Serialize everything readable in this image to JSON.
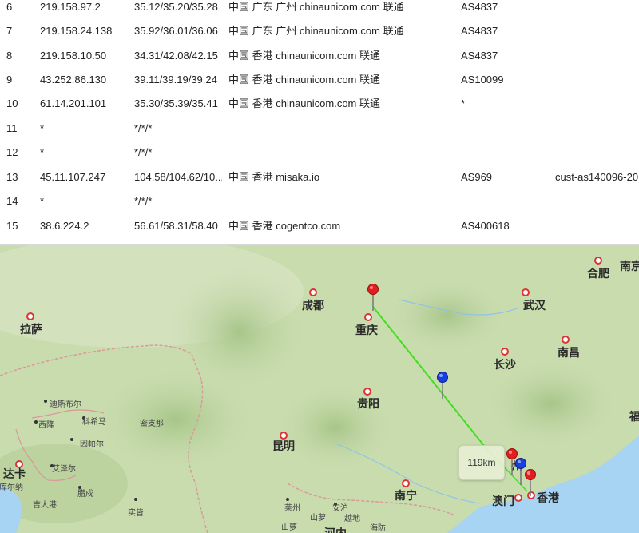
{
  "trace": {
    "rows": [
      {
        "hop": "6",
        "ip": "219.158.97.2",
        "latency": "35.12/35.20/35.28",
        "location": "中国 广东 广州 chinaunicom.com 联通",
        "asn": "AS4837",
        "host": ""
      },
      {
        "hop": "7",
        "ip": "219.158.24.138",
        "latency": "35.92/36.01/36.06",
        "location": "中国 广东 广州 chinaunicom.com 联通",
        "asn": "AS4837",
        "host": ""
      },
      {
        "hop": "8",
        "ip": "219.158.10.50",
        "latency": "34.31/42.08/42.15",
        "location": "中国 香港 chinaunicom.com 联通",
        "asn": "AS4837",
        "host": ""
      },
      {
        "hop": "9",
        "ip": "43.252.86.130",
        "latency": "39.11/39.19/39.24",
        "location": "中国 香港 chinaunicom.com 联通",
        "asn": "AS10099",
        "host": ""
      },
      {
        "hop": "10",
        "ip": "61.14.201.101",
        "latency": "35.30/35.39/35.41",
        "location": "中国 香港 chinaunicom.com 联通",
        "asn": "*",
        "host": ""
      },
      {
        "hop": "11",
        "ip": "*",
        "latency": "*/*/*",
        "location": "",
        "asn": "",
        "host": ""
      },
      {
        "hop": "12",
        "ip": "*",
        "latency": "*/*/*",
        "location": "",
        "asn": "",
        "host": ""
      },
      {
        "hop": "13",
        "ip": "45.11.107.247",
        "latency": "104.58/104.62/10...",
        "location": "中国 香港 misaka.io",
        "asn": "AS969",
        "host": "cust-as140096-20"
      },
      {
        "hop": "14",
        "ip": "*",
        "latency": "*/*/*",
        "location": "",
        "asn": "",
        "host": ""
      },
      {
        "hop": "15",
        "ip": "38.6.224.2",
        "latency": "56.61/58.31/58.40",
        "location": "中国 香港 cogentco.com",
        "asn": "AS400618",
        "host": ""
      }
    ]
  },
  "map": {
    "distance_label": "119km",
    "colors": {
      "route_line": "#44dd22",
      "pin_red": "#e02020",
      "pin_blue": "#1a3fe0",
      "land": "#c9dcae",
      "mountains": "#b2cc92",
      "sea": "#a6d4f2",
      "border": "#d99a9a"
    },
    "cities": {
      "chengdu": "成都",
      "chongqing": "重庆",
      "wuhan": "武汉",
      "hefei": "合肥",
      "nanjing": "南京",
      "lhasa": "拉萨",
      "changsha": "长沙",
      "nanchang": "南昌",
      "guiyang": "贵阳",
      "kunming": "昆明",
      "nanning": "南宁",
      "macau": "澳门",
      "hongkong": "香港",
      "guangzhou_partial": "州",
      "fu": "福",
      "thimphu": "迪斯布尔",
      "xilong": "西隆",
      "kohima": "科希马",
      "imphal": "因帕尔",
      "aizawl": "艾泽尔",
      "mizo": "密支那",
      "dhaka": "达卡",
      "dhaka_sub": "库尔纳",
      "chittagong": "吉大港",
      "lashio": "腊戍",
      "mandalay": "实皆",
      "hanoi_area": "河内",
      "haiphong": "海防",
      "laocai": "安沪",
      "yuexi": "越地",
      "sanya": "山萝",
      "xiangkhoang": "莱州"
    }
  }
}
